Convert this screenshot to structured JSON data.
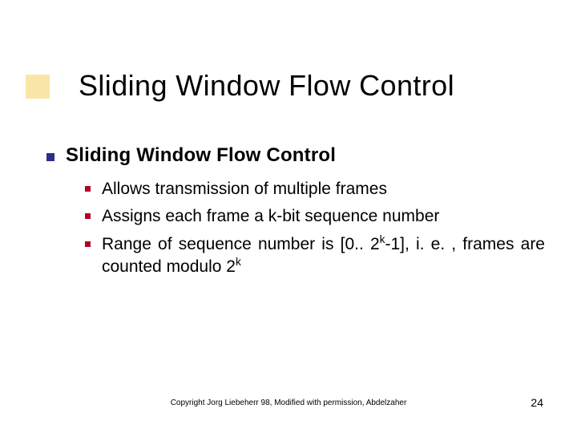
{
  "title": "Sliding Window Flow Control",
  "heading": "Sliding Window Flow Control",
  "points": {
    "p0": "Allows transmission of multiple frames",
    "p1": "Assigns each frame a k-bit sequence number",
    "p2a": "Range of sequence number is [0.. 2",
    "p2b": "-1], i. e. , frames are counted modulo 2",
    "sup": "k"
  },
  "footer": "Copyright Jorg Liebeherr 98, Modified with permission, Abdelzaher",
  "pagenum": "24"
}
